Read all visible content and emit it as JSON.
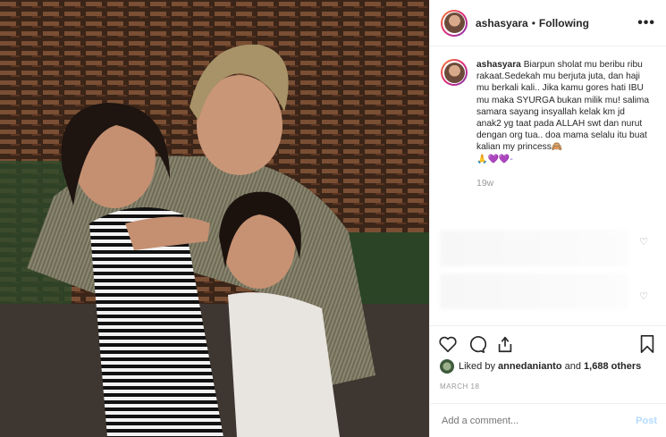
{
  "post": {
    "username": "ashasyara",
    "follow_status": "Following",
    "more_label": "•••",
    "caption_username": "ashasyara",
    "caption_text": "Biarpun sholat mu beribu ribu rakaat.Sedekah mu berjuta juta, dan haji mu berkali kali.. Jika kamu gores hati IBU mu maka SYURGA bukan milik mu! salima samara sayang insyallah kelak km jd anak2 yg taat pada ALLAH swt dan nurut dengan org tua.. doa mama selalu itu buat kalian my princess",
    "caption_emoji_end": "🙏💜💜-",
    "caption_emoji_princess": "🙈",
    "time_ago": "19w",
    "likes_prefix": "Liked by",
    "likes_user": "annedanianto",
    "likes_and": "and",
    "likes_count": "1,688 others",
    "date": "MARCH 18",
    "comment_placeholder": "Add a comment...",
    "post_label": "Post"
  },
  "icons": {
    "heart": "heart-icon",
    "comment": "comment-icon",
    "share": "share-icon",
    "save": "bookmark-icon"
  },
  "colors": {
    "accent": "#3897f0",
    "post_disabled": "#b3dbff"
  }
}
